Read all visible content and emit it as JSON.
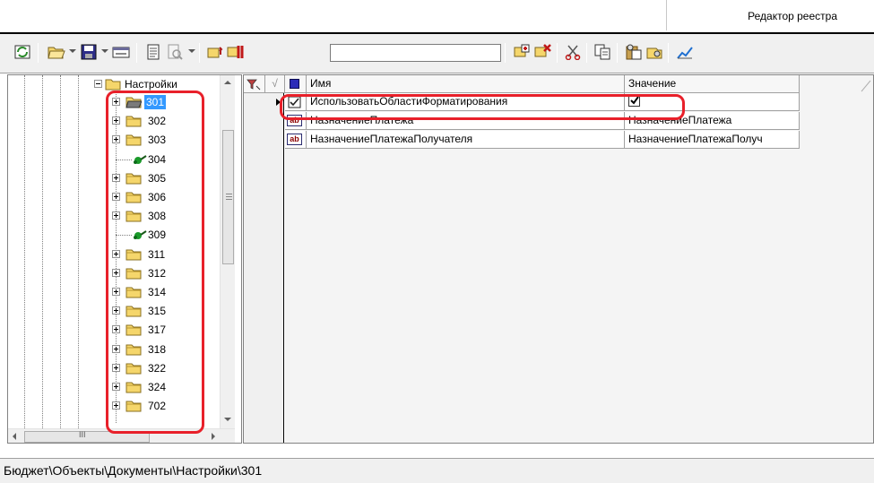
{
  "window": {
    "title": "Редактор реестра"
  },
  "toolbar": {
    "icons": [
      "refresh-icon",
      "open-icon",
      "save-icon",
      "form-icon",
      "properties-icon",
      "print-preview-icon",
      "find-icon",
      "find-next-icon",
      "add-object-icon",
      "delete-object-icon",
      "cut-icon",
      "copy-icon",
      "paste-icon",
      "settings-icon",
      "chart-icon"
    ],
    "search_value": ""
  },
  "tree": {
    "parent_label": "Настройки",
    "items": [
      {
        "label": "301",
        "kind": "folder-open",
        "selected": true
      },
      {
        "label": "302",
        "kind": "folder"
      },
      {
        "label": "303",
        "kind": "folder"
      },
      {
        "label": "304",
        "kind": "leaf"
      },
      {
        "label": "305",
        "kind": "folder"
      },
      {
        "label": "306",
        "kind": "folder"
      },
      {
        "label": "308",
        "kind": "folder"
      },
      {
        "label": "309",
        "kind": "leaf"
      },
      {
        "label": "311",
        "kind": "folder"
      },
      {
        "label": "312",
        "kind": "folder"
      },
      {
        "label": "314",
        "kind": "folder"
      },
      {
        "label": "315",
        "kind": "folder"
      },
      {
        "label": "317",
        "kind": "folder"
      },
      {
        "label": "318",
        "kind": "folder"
      },
      {
        "label": "322",
        "kind": "folder"
      },
      {
        "label": "324",
        "kind": "folder"
      },
      {
        "label": "702",
        "kind": "folder"
      }
    ],
    "hscroll_glyph": "III",
    "vscroll_glyph": "≡"
  },
  "grid": {
    "columns": {
      "name": "Имя",
      "value": "Значение"
    },
    "rows": [
      {
        "type": "bool",
        "name": "ИспользоватьОбластиФорматирования",
        "value": "",
        "checked": true,
        "current": true
      },
      {
        "type": "string",
        "name": "НазначениеПлатежа",
        "value": "НазначениеПлатежа"
      },
      {
        "type": "string",
        "name": "НазначениеПлатежаПолучателя",
        "value": "НазначениеПлатежаПолуч"
      }
    ],
    "string_icon_text": "ab"
  },
  "status": {
    "path": "Бюджет\\Объекты\\Документы\\Настройки\\301"
  },
  "colors": {
    "highlight": "#e8202a",
    "selection": "#3399ff",
    "folder": "#f5d66b"
  }
}
